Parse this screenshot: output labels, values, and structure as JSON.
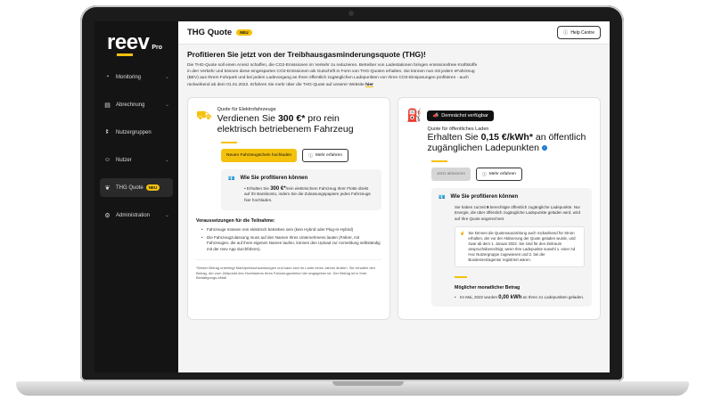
{
  "sidebar": {
    "brand": "reev",
    "brand_suffix": "Pro",
    "items": [
      {
        "label": "Monitoring",
        "icon": "gauge-icon"
      },
      {
        "label": "Abrechnung",
        "icon": "invoice-icon"
      },
      {
        "label": "Nutzergruppen",
        "icon": "group-icon"
      },
      {
        "label": "Nutzer",
        "icon": "user-icon"
      },
      {
        "label": "THG Quote",
        "icon": "leaf-icon",
        "badge": "NEU"
      },
      {
        "label": "Administration",
        "icon": "settings-sliders-icon"
      }
    ]
  },
  "header": {
    "title": "THG Quote",
    "badge": "NEU",
    "help_label": "Help Centre"
  },
  "main": {
    "headline": "Profitieren Sie jetzt von der Treibhausgasminderungsquote (THG)!",
    "intro": "Die THG-Quote soll einen Anreiz schaffen, die CO2-Emissionen im Verkehr zu reduzieren. Betreiber von Ladestationen bringen emissionsfreie Kraftstoffe in den Verkehr und können diese eingesparten CO2-Emissionen als Gutschrift in Form von THG-Quoten erhalten. Sie können nun mit jedem eFahrzeug (BEV) aus Ihrem Fuhrpark und bei jedem Ladevorgang an Ihren öffentlich zugänglichen Ladepunkten von Ihren CO2-Einsparungen profitieren - auch rückwirkend ab dem 01.01.2022. Erfahren Sie mehr über die THG-Quote auf unserer Website ",
    "intro_link": "hier"
  },
  "left_card": {
    "kicker": "Quote für Elektrofahrzeuge",
    "title_pre": "Verdienen Sie ",
    "title_amount": "300 €*",
    "title_post": " pro rein elektrisch betriebenem Fahrzeug",
    "primary_button": "Neuen Fahrzeugschein hochladen",
    "secondary_button": "Mehr erfahren",
    "benefit_title": "Wie Sie profitieren können",
    "benefit_pre": "Erhalten Sie ",
    "benefit_amount": "300 €*",
    "benefit_post": "/rein elektrischem Fahrzeug Ihrer Flotte direkt auf Ihr Bankkonto, indem Sie die Zulassungspapiere jedes Fahrzeugs hier hochladen.",
    "requirements_title": "Voraussetzungen für die Teilnahme:",
    "requirements": [
      "Fahrzeuge müssen rein elektrisch betrieben sein (kein Hybrid oder Plug-In-Hybrid)",
      "Die Fahrzeugzulassung muss auf den Namen Ihres Unternehmens lauten (Fahrer, mit Fahrzeugen, die auf ihren eigenen Namen laufen, können den Upload zur Anmeldung selbständig mit der reev App durchführen)."
    ],
    "footnote": "*Dieser Betrag unterliegt Marktpreisschwankungen und kann sich im Laufe eines Jahres ändern. Sie erhalten den Betrag, der zum Zeitpunkt des Hochladens Ihres Fahrzeugscheins hier angegeben ist. Der Betrag ist in Ihrer Bestätigungs-eMail"
  },
  "right_card": {
    "soon_label": "Demnächst verfügbar",
    "kicker": "Quote für öffentliches Laden",
    "title_pre": "Erhalten Sie ",
    "title_amount": "0,15 €/kWh*",
    "title_post": " an öffentlich zugänglichen Ladepunkten",
    "disabled_button": "Jetzt aktivieren",
    "secondary_button": "Mehr erfahren",
    "benefit_title": "Wie Sie profitieren können",
    "benefit_pre": "Sie haben zurzeit ",
    "benefit_count": "9",
    "benefit_post": " berechtigte öffentlich zugängliche Ladepunkte. Nur Energie, die über öffentlich zugängliche Ladepunkte geladen wird, wird auf Ihre Quote angerechnet.",
    "note": "Sie können die Quotenauszahlung auch rückwirkend für Strom erhalten, der vor der Aktivierung der Quote geladen wurde, und zwar ab dem 1. Januar 2022. Sie sind für den Zeitraum anspruchsberechtigt, wenn Ihre Ladepunkte sowohl 1. einer Ad Hoc Nutzergruppe zugewiesen und 2. bei der Bundesnetzagentur registriert waren.",
    "monthly_title": "Möglicher monatlicher Betrag",
    "monthly_pre": "Im Mai, 2022 wurden ",
    "monthly_amount": "0,00 kWh",
    "monthly_post": " an Ihren 41 Ladepunkten geladen."
  },
  "colors": {
    "accent": "#f4c20d",
    "sidebar": "#141414",
    "info": "#1976d2"
  }
}
